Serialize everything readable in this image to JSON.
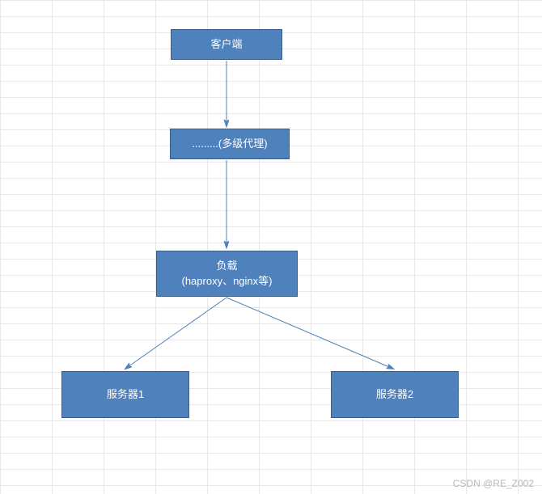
{
  "nodes": {
    "client": {
      "label": "客户端"
    },
    "proxy": {
      "label": ".........(多级代理)"
    },
    "lb": {
      "line1": "负载",
      "line2": "(haproxy、nginx等)"
    },
    "server1": {
      "label": "服务器1"
    },
    "server2": {
      "label": "服务器2"
    }
  },
  "watermark": {
    "prefix": "CSDN ",
    "author": "@RE_Z002"
  },
  "chart_data": {
    "type": "diagram",
    "title": "",
    "nodes": [
      {
        "id": "client",
        "label": "客户端"
      },
      {
        "id": "proxy",
        "label": ".........(多级代理)"
      },
      {
        "id": "lb",
        "label": "负载 (haproxy、nginx等)"
      },
      {
        "id": "server1",
        "label": "服务器1"
      },
      {
        "id": "server2",
        "label": "服务器2"
      }
    ],
    "edges": [
      {
        "from": "client",
        "to": "proxy"
      },
      {
        "from": "proxy",
        "to": "lb"
      },
      {
        "from": "lb",
        "to": "server1"
      },
      {
        "from": "lb",
        "to": "server2"
      }
    ]
  }
}
